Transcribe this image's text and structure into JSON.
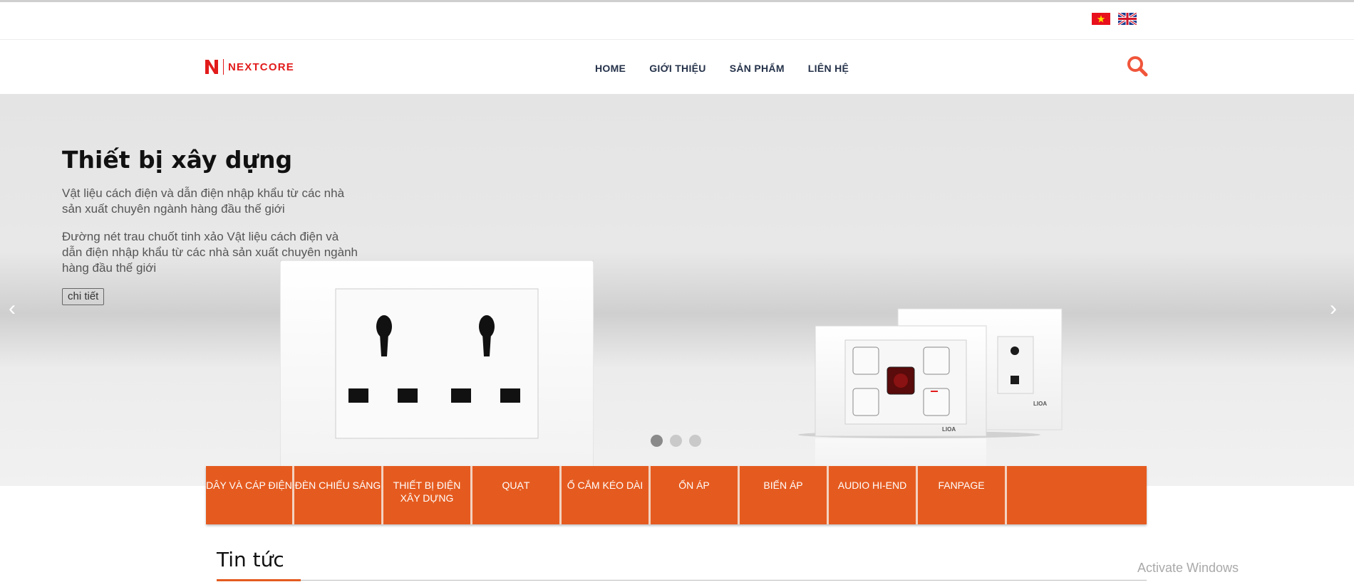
{
  "lang": {
    "vi_flag": "flag-vn-icon",
    "en_flag": "flag-en-icon"
  },
  "logo": {
    "text": "NEXTCORE",
    "brand_color": "#e21b1b"
  },
  "nav": {
    "items": [
      "HOME",
      "GIỚI THIỆU",
      "SẢN PHẨM",
      "LIÊN HỆ"
    ],
    "search_icon": "search-icon",
    "accent": "#f0553a"
  },
  "hero": {
    "title": "Thiết bị xây dựng",
    "para1": "Vật liệu cách điện và dẫn điện nhập khẩu từ các nhà sản xuất chuyên ngành hàng đầu thế giới",
    "para2": "Đường nét trau chuốt tinh xảo Vật liệu cách điện và dẫn điện nhập khẩu từ các nhà sản xuất chuyên ngành hàng đầu thế giới",
    "button": "chi tiết",
    "prev": "‹",
    "next": "›",
    "slide_count": 3,
    "active_slide": 1
  },
  "categories": [
    "DÂY VÀ CÁP ĐIỆN",
    "ĐÈN CHIẾU SÁNG",
    "THIẾT BỊ ĐIỆN XÂY DỰNG",
    "QUẠT",
    "Ổ CẮM KÉO DÀI",
    "ỔN ÁP",
    "BIẾN ÁP",
    "AUDIO HI-END",
    "FANPAGE"
  ],
  "category_color": "#e55b1f",
  "news": {
    "title": "Tin tức"
  },
  "watermark": "Activate Windows"
}
